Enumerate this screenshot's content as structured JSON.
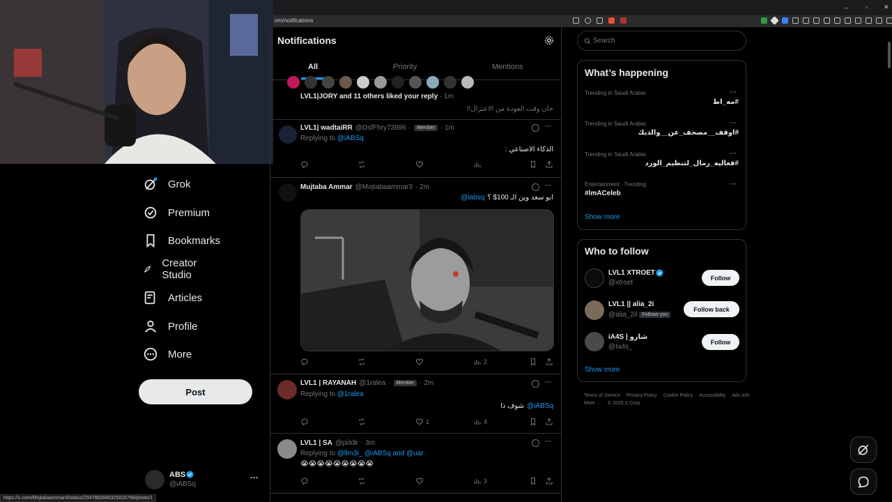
{
  "browser": {
    "url": "om/notifications",
    "status_url": "https://x.com/Mojtabaammar3/status/2047862840325816798/photo/1"
  },
  "nav": {
    "items": [
      {
        "label": "Grok",
        "icon": "grok-icon"
      },
      {
        "label": "Premium",
        "icon": "premium-icon"
      },
      {
        "label": "Bookmarks",
        "icon": "bookmark-icon"
      },
      {
        "label": "Creator Studio",
        "icon": "rocket-icon"
      },
      {
        "label": "Articles",
        "icon": "article-icon"
      },
      {
        "label": "Profile",
        "icon": "profile-icon"
      },
      {
        "label": "More",
        "icon": "more-icon"
      }
    ],
    "post_label": "Post",
    "account": {
      "name": "ABS",
      "handle": "@iABSq"
    }
  },
  "notifications": {
    "title": "Notifications",
    "tabs": [
      "All",
      "Priority",
      "Mentions"
    ],
    "active_tab": "All",
    "like_group": {
      "text": "LVL1|JORY and 11 others liked your reply",
      "time": "· 1m",
      "quote": "حان وقت العودة من الاعتزال!!"
    },
    "posts": [
      {
        "name": "LVL1| wadtaiRR",
        "handle": "@DsfFhry73996",
        "badge": "Member",
        "time": "· 1m",
        "replying_prefix": "Replying to",
        "replying_to": "@iABSq",
        "text": "الذكاء الاصناعي :",
        "views": ""
      },
      {
        "name": "Mujtaba Ammar",
        "handle": "@Mojtabaammar3",
        "time": "· 2m",
        "mention": "@iabsq",
        "text": "ابو سعد وين الـ 100$ ؟",
        "views": "2"
      },
      {
        "name": "LVL1 | RAYANAH",
        "handle": "@1ralea",
        "badge": "Member",
        "time": "· 2m",
        "replying_prefix": "Replying to",
        "replying_to": "@1ralea",
        "mention": "@iABSq",
        "text": "شوف ذا",
        "likes": "1",
        "views": "4"
      },
      {
        "name": "LVL1 | SA",
        "handle": "@piildk",
        "time": "· 3m",
        "replying_prefix": "Replying to",
        "replying_to": "@llm3i_ @iABSq and @uar",
        "text": "😭😭😭😭😭😭😭😭😭",
        "views": "3"
      }
    ]
  },
  "search": {
    "placeholder": "Search"
  },
  "whats_happening": {
    "title": "What’s happening",
    "trends": [
      {
        "context": "Trending in Saudi Arabia",
        "name": "#مه_اط"
      },
      {
        "context": "Trending in Saudi Arabia",
        "name": "#اوقف__مصحف_عن__والديك"
      },
      {
        "context": "Trending in Saudi Arabia",
        "name": "#فعاليه_رمال_لتنظيم_الورد"
      },
      {
        "context": "Entertainment · Trending",
        "name": "#lmACeleb"
      }
    ],
    "show_more": "Show more"
  },
  "who_to_follow": {
    "title": "Who to follow",
    "accounts": [
      {
        "name": "LVL1 XTROET",
        "handle": "@xtroet",
        "verified": true,
        "button": "Follow"
      },
      {
        "name": "LVL1 || alia_2i",
        "handle": "@alia_2il",
        "follows_you": "Follows you",
        "button": "Follow back"
      },
      {
        "name": "iA4S | شارو",
        "handle": "@Ia4s_",
        "button": "Follow"
      }
    ],
    "show_more": "Show more"
  },
  "footer": {
    "links": [
      "Terms of Service",
      "Privacy Policy",
      "Cookie Policy",
      "Accessibility",
      "Ads info",
      "More ···",
      "© 2026 X Corp."
    ]
  },
  "colors": {
    "accent": "#1d9bf0",
    "background": "#000000",
    "border": "#2f3336",
    "text": "#e7e9ea",
    "muted": "#71767b"
  }
}
